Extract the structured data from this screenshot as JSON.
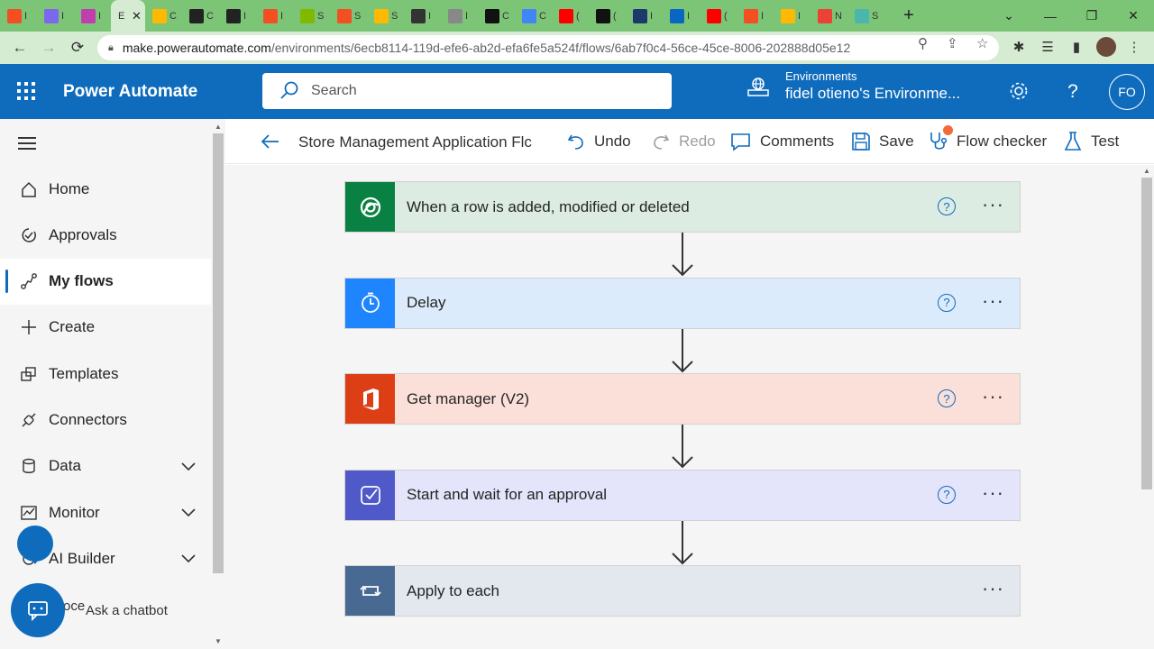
{
  "browser": {
    "tabs": [
      {
        "label": "I",
        "color": "#f25022"
      },
      {
        "label": "I",
        "color": "#7b68ee"
      },
      {
        "label": "I",
        "color": "#c03fae"
      },
      {
        "label": "E",
        "color": "#ffffff",
        "active": true
      },
      {
        "label": "C",
        "color": "#ffb900"
      },
      {
        "label": "C",
        "color": "#222222"
      },
      {
        "label": "I",
        "color": "#222222"
      },
      {
        "label": "I",
        "color": "#f25022"
      },
      {
        "label": "S",
        "color": "#7fba00"
      },
      {
        "label": "S",
        "color": "#f25022"
      },
      {
        "label": "S",
        "color": "#ffb900"
      },
      {
        "label": "I",
        "color": "#333333"
      },
      {
        "label": "I",
        "color": "#888888"
      },
      {
        "label": "C",
        "color": "#111111"
      },
      {
        "label": "C",
        "color": "#4285f4"
      },
      {
        "label": "(",
        "color": "#ff0000"
      },
      {
        "label": "(",
        "color": "#111111"
      },
      {
        "label": "I",
        "color": "#1b3a6b"
      },
      {
        "label": "I",
        "color": "#0a66c2"
      },
      {
        "label": "(",
        "color": "#ff0000"
      },
      {
        "label": "I",
        "color": "#f25022"
      },
      {
        "label": "I",
        "color": "#ffb900"
      },
      {
        "label": "N",
        "color": "#ea4335"
      },
      {
        "label": "S",
        "color": "#4db6ac"
      }
    ],
    "url_host": "make.powerautomate.com",
    "url_path": "/environments/6ecb8114-119d-efe6-ab2d-efa6fe5a524f/flows/6ab7f0c4-56ce-45ce-8006-202888d05e12"
  },
  "header": {
    "brand": "Power Automate",
    "search_placeholder": "Search",
    "env_label": "Environments",
    "env_name": "fidel otieno's Environme...",
    "user_initials": "FO",
    "brand_color": "#0f6cbd"
  },
  "sidebar": {
    "items": [
      {
        "label": "Home",
        "icon": "home-icon"
      },
      {
        "label": "Approvals",
        "icon": "approvals-icon"
      },
      {
        "label": "My flows",
        "icon": "flows-icon",
        "selected": true
      },
      {
        "label": "Create",
        "icon": "plus-icon"
      },
      {
        "label": "Templates",
        "icon": "templates-icon"
      },
      {
        "label": "Connectors",
        "icon": "connectors-icon"
      },
      {
        "label": "Data",
        "icon": "data-icon",
        "expandable": true
      },
      {
        "label": "Monitor",
        "icon": "monitor-icon",
        "expandable": true
      },
      {
        "label": "AI Builder",
        "icon": "ai-builder-icon",
        "expandable": true
      }
    ],
    "partial_text": "oce",
    "chatbot_label": "Ask a chatbot"
  },
  "commandbar": {
    "flow_name": "Store Management Application Flc",
    "undo": "Undo",
    "redo": "Redo",
    "comments": "Comments",
    "save": "Save",
    "flow_checker": "Flow checker",
    "test": "Test"
  },
  "flow": {
    "steps": [
      {
        "title": "When a row is added, modified or deleted",
        "bg": "#dcece3",
        "icon_bg": "#088142",
        "icon": "dataverse-icon",
        "help": true
      },
      {
        "title": "Delay",
        "bg": "#dcebfb",
        "icon_bg": "#1f85ff",
        "icon": "timer-icon",
        "help": true
      },
      {
        "title": "Get manager (V2)",
        "bg": "#fbe0d9",
        "icon_bg": "#dc3e15",
        "icon": "office-icon",
        "help": true
      },
      {
        "title": "Start and wait for an approval",
        "bg": "#e4e4fa",
        "icon_bg": "#4f59c8",
        "icon": "approval-icon",
        "help": true
      },
      {
        "title": "Apply to each",
        "bg": "#e3e7ee",
        "icon_bg": "#486991",
        "icon": "loop-icon",
        "help": false
      }
    ]
  }
}
